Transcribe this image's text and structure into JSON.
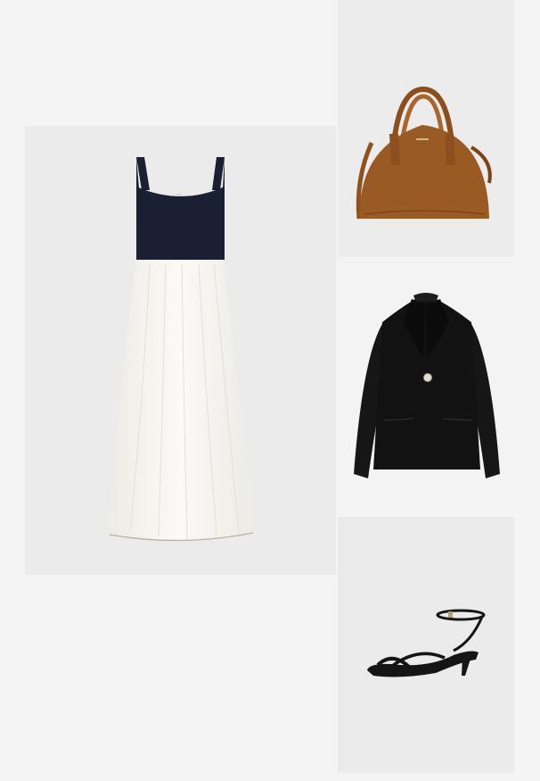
{
  "collage": {
    "items": [
      {
        "id": "dress",
        "image": "dress-image"
      },
      {
        "id": "bag",
        "image": "handbag-image"
      },
      {
        "id": "blazer",
        "image": "blazer-image"
      },
      {
        "id": "sandal",
        "image": "sandal-image"
      }
    ]
  },
  "colors": {
    "page_background": "#f4f4f4",
    "dress_bodice": "#1b1f33",
    "dress_skirt": "#f7f5f0",
    "bag_leather": "#9a5a24",
    "blazer": "#121212",
    "sandal": "#151515"
  }
}
